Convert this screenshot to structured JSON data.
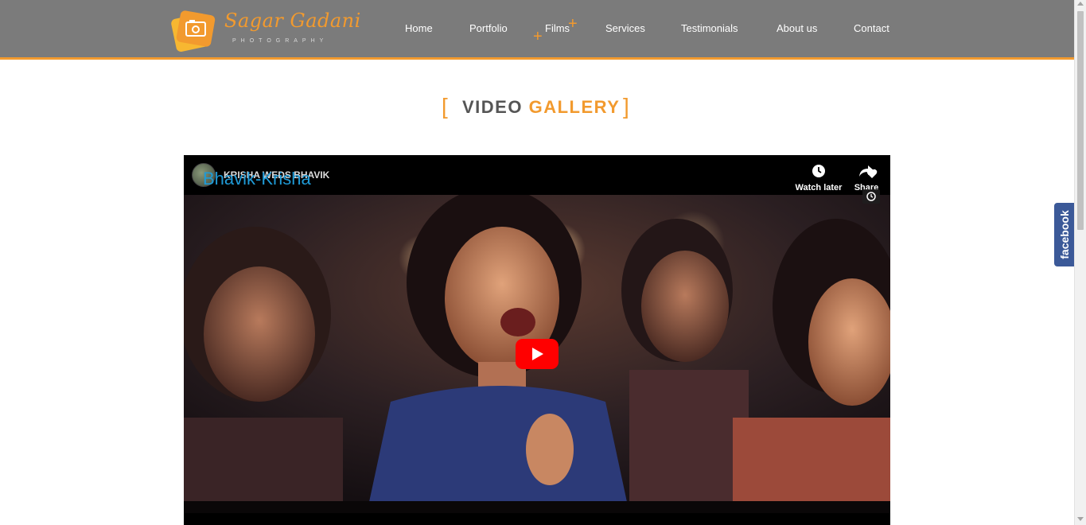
{
  "brand": {
    "name": "Sagar Gadani",
    "tagline": "PHOTOGRAPHY",
    "accent_color": "#f29a2e",
    "header_color": "#7b7b7b"
  },
  "nav": {
    "items": [
      {
        "label": "Home"
      },
      {
        "label": "Portfolio"
      },
      {
        "label": "Films"
      },
      {
        "label": "Services"
      },
      {
        "label": "Testimonials"
      },
      {
        "label": "About us"
      },
      {
        "label": "Contact"
      }
    ],
    "active": "Films"
  },
  "heading": {
    "word1": "VIDEO",
    "word2": "GALLERY"
  },
  "video": {
    "title": "Bhavik-Krisha",
    "channel_title": "KRISHA WEDS BHAVIK",
    "watch_later_label": "Watch later",
    "share_label": "Share",
    "play_button_color": "#ff0000",
    "title_color": "#1f9ad6"
  },
  "social": {
    "facebook_label": "facebook",
    "facebook_color": "#3b5998"
  }
}
